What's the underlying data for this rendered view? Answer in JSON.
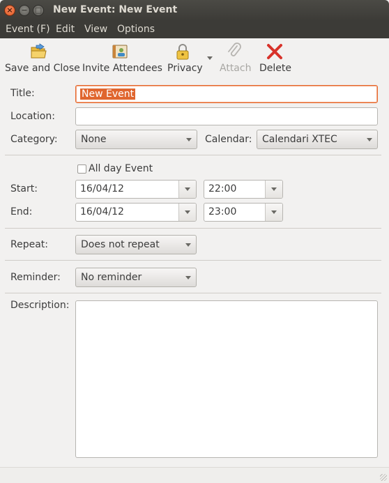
{
  "window": {
    "title": "New Event: New Event"
  },
  "menu": {
    "event": "Event (F)",
    "edit": "Edit",
    "view": "View",
    "options": "Options"
  },
  "toolbar": {
    "save_close": "Save and Close",
    "invite": "Invite Attendees",
    "privacy": "Privacy",
    "attach": "Attach",
    "delete": "Delete"
  },
  "form": {
    "title_label": "Title:",
    "title_value": "New Event",
    "location_label": "Location:",
    "location_value": "",
    "category_label": "Category:",
    "category_value": "None",
    "calendar_label": "Calendar:",
    "calendar_value": "Calendari XTEC",
    "allday_label": "All day Event",
    "allday_checked": false,
    "start_label": "Start:",
    "start_date": "16/04/12",
    "start_time": "22:00",
    "end_label": "End:",
    "end_date": "16/04/12",
    "end_time": "23:00",
    "repeat_label": "Repeat:",
    "repeat_value": "Does not repeat",
    "reminder_label": "Reminder:",
    "reminder_value": "No reminder",
    "description_label": "Description:",
    "description_value": ""
  },
  "colors": {
    "accent": "#e0662f",
    "titlebar": "#3c3b37",
    "close_button": "#e05a23"
  }
}
